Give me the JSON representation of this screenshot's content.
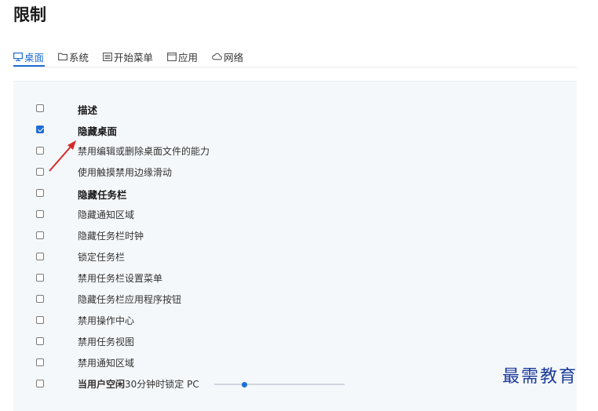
{
  "page": {
    "title": "限制"
  },
  "tabs": [
    {
      "label": "桌面",
      "icon": "monitor-icon",
      "active": true
    },
    {
      "label": "系统",
      "icon": "folder-icon",
      "active": false
    },
    {
      "label": "开始菜单",
      "icon": "start-menu-icon",
      "active": false
    },
    {
      "label": "应用",
      "icon": "app-window-icon",
      "active": false
    },
    {
      "label": "网络",
      "icon": "cloud-icon",
      "active": false
    }
  ],
  "colors": {
    "accent": "#1f6ed4",
    "panel_bg": "#f5f8fb",
    "annotation_arrow": "#d62a2a",
    "watermark": "#1b3a9a"
  },
  "options": [
    {
      "label": "描述",
      "checked": false,
      "bold": true
    },
    {
      "label": "隐藏桌面",
      "checked": true,
      "bold": true
    },
    {
      "label": "禁用编辑或删除桌面文件的能力",
      "checked": false,
      "bold": false
    },
    {
      "label": "使用触摸禁用边缘滑动",
      "checked": false,
      "bold": false
    },
    {
      "label": "隐藏任务栏",
      "checked": false,
      "bold": true
    },
    {
      "label": "隐藏通知区域",
      "checked": false,
      "bold": false
    },
    {
      "label": "隐藏任务栏时钟",
      "checked": false,
      "bold": false
    },
    {
      "label": "锁定任务栏",
      "checked": false,
      "bold": false
    },
    {
      "label": "禁用任务栏设置菜单",
      "checked": false,
      "bold": false
    },
    {
      "label": "隐藏任务栏应用程序按钮",
      "checked": false,
      "bold": false
    },
    {
      "label": "禁用操作中心",
      "checked": false,
      "bold": false
    },
    {
      "label": "禁用任务视图",
      "checked": false,
      "bold": false
    },
    {
      "label": "禁用通知区域",
      "checked": false,
      "bold": false
    }
  ],
  "idle_lock": {
    "prefix": "当用户空闲",
    "minutes": "30",
    "suffix": "分钟时锁定 PC",
    "checked": false,
    "slider_fraction": 0.23
  },
  "watermark": {
    "text": "最需教育"
  }
}
